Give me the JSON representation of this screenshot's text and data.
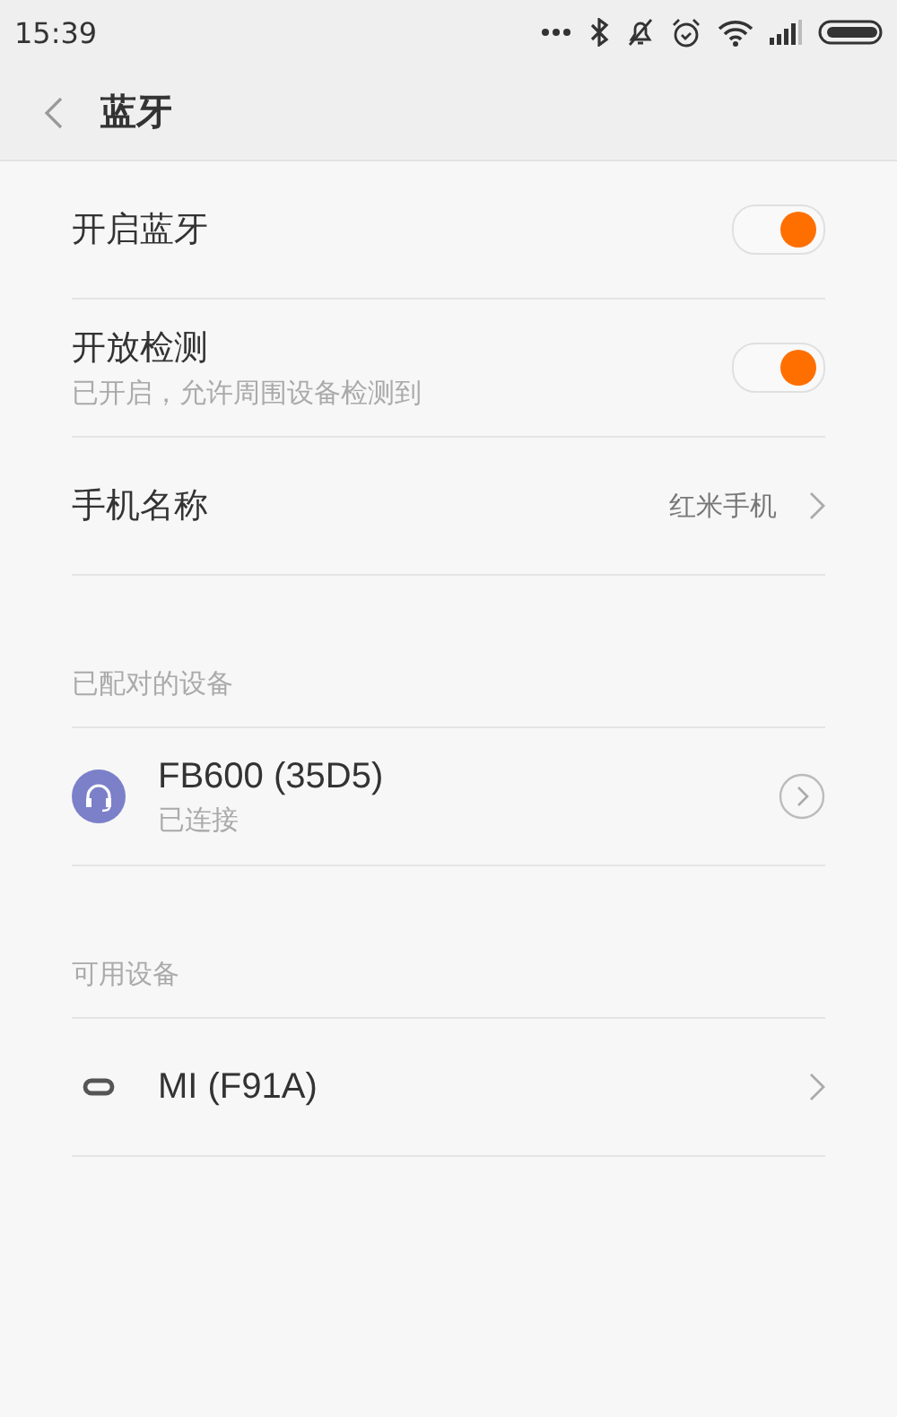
{
  "status_bar": {
    "time": "15:39"
  },
  "header": {
    "title": "蓝牙"
  },
  "settings": [
    {
      "kind": "toggle",
      "label": "开启蓝牙",
      "on": true
    },
    {
      "kind": "toggle",
      "label": "开放检测",
      "sublabel": "已开启，允许周围设备检测到",
      "on": true
    },
    {
      "kind": "value",
      "label": "手机名称",
      "value": "红米手机"
    }
  ],
  "sections": [
    {
      "title": "已配对的设备",
      "devices": [
        {
          "name": "FB600 (35D5)",
          "status": "已连接",
          "kind": "paired"
        }
      ]
    },
    {
      "title": "可用设备",
      "devices": [
        {
          "name": "MI (F91A)",
          "kind": "available"
        }
      ]
    }
  ]
}
